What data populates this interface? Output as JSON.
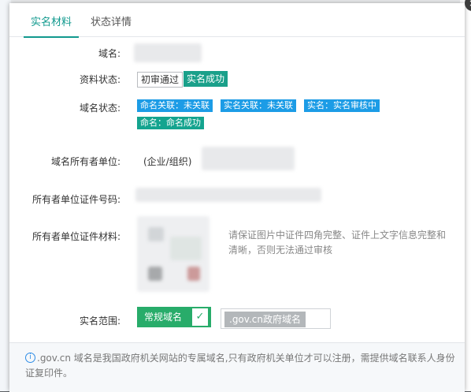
{
  "close_icon": "×",
  "tabs": [
    {
      "label": "实名材料",
      "active": true
    },
    {
      "label": "状态详情",
      "active": false
    }
  ],
  "fields": {
    "domain_label": "域名:",
    "material_status_label": "资料状态:",
    "domain_status_label": "域名状态:",
    "owner_unit_label": "域名所有者单位:",
    "owner_cert_no_label": "所有者单位证件号码:",
    "owner_cert_material_label": "所有者单位证件材料:",
    "scope_label": "实名范围:"
  },
  "material_status": {
    "initial": "初审通过",
    "success": "实名成功"
  },
  "domain_status_tags": [
    "命名关联：未关联",
    "实名关联：未关联",
    "实名：实名审核中",
    "命名：命名成功"
  ],
  "owner_unit_value": "(企业/组织)",
  "cert_hint": "请保证图片中证件四角完整、证件上文字信息完整和清晰，否则无法通过审核",
  "scope_options": [
    {
      "label": "常规域名",
      "selected": true
    },
    {
      "label": ".gov.cn政府域名",
      "selected": false
    }
  ],
  "check_icon": "✓",
  "info_icon": "i",
  "footer_note": ".gov.cn 域名是我国政府机关网站的专属域名,只有政府机关单位才可以注册，需提供域名联系人身份证复印件。",
  "colors": {
    "accent": "#11998e",
    "tag_blue": "#1c9ce6",
    "tag_green": "#14a48f",
    "scope_green": "#28ac6a"
  }
}
